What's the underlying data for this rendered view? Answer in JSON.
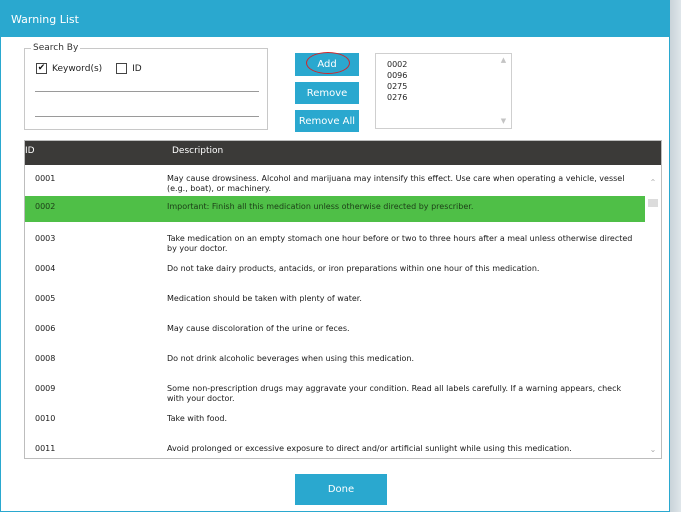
{
  "window": {
    "title": "Warning List"
  },
  "search": {
    "legend": "Search By",
    "keyword_label": "Keyword(s)",
    "keyword_checked": true,
    "id_label": "ID",
    "id_checked": false,
    "input_value": "",
    "input_placeholder": ""
  },
  "buttons": {
    "add": "Add",
    "remove": "Remove",
    "remove_all": "Remove All",
    "done": "Done"
  },
  "selected_ids": [
    "0002",
    "0096",
    "0275",
    "0276"
  ],
  "table": {
    "columns": {
      "id": "ID",
      "description": "Description"
    },
    "selected_id": "0002",
    "rows": [
      {
        "id": "0001",
        "description": "May cause drowsiness. Alcohol and marijuana may intensify this effect. Use care when operating a vehicle, vessel (e.g., boat), or machinery."
      },
      {
        "id": "0002",
        "description": "Important: Finish all this medication unless otherwise directed by prescriber."
      },
      {
        "id": "0003",
        "description": "Take medication on an empty stomach one hour before or two to three hours after a meal unless otherwise directed by your doctor."
      },
      {
        "id": "0004",
        "description": "Do not take dairy products, antacids, or iron preparations within one hour of this medication."
      },
      {
        "id": "0005",
        "description": "Medication should be taken with plenty of water."
      },
      {
        "id": "0006",
        "description": "May cause discoloration of the urine or feces."
      },
      {
        "id": "0008",
        "description": "Do not drink alcoholic beverages when using this medication."
      },
      {
        "id": "0009",
        "description": "Some non-prescription drugs may aggravate your condition. Read all labels carefully. If a warning appears, check with your doctor."
      },
      {
        "id": "0010",
        "description": "Take with food."
      },
      {
        "id": "0011",
        "description": "Avoid prolonged or excessive exposure to direct and/or artificial sunlight while using this medication."
      }
    ]
  },
  "colors": {
    "accent": "#2aa8cf",
    "header_bg": "#3b3a38",
    "selected_row": "#4fbf47",
    "highlight_ring": "#d0252a"
  }
}
